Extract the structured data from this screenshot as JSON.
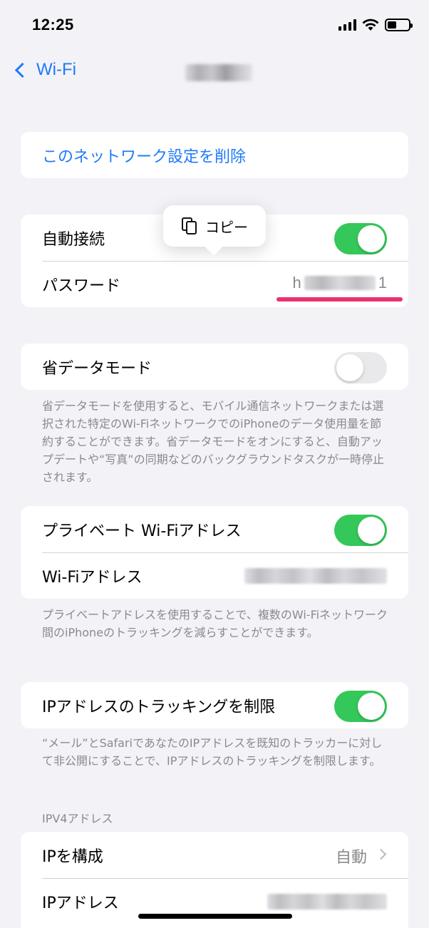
{
  "status_bar": {
    "time": "12:25"
  },
  "nav": {
    "back_label": "Wi-Fi"
  },
  "forget_network": {
    "label": "このネットワーク設定を削除"
  },
  "connection": {
    "auto_join": {
      "label": "自動接続",
      "on": true
    },
    "password": {
      "label": "パスワード",
      "first_char": "h",
      "last_char": "1"
    }
  },
  "copy_popup": {
    "label": "コピー"
  },
  "low_data": {
    "label": "省データモード",
    "on": false,
    "footnote": "省データモードを使用すると、モバイル通信ネットワークまたは選択された特定のWi-FiネットワークでのiPhoneのデータ使用量を節約することができます。省データモードをオンにすると、自動アップデートや“写真”の同期などのバックグラウンドタスクが一時停止されます。"
  },
  "private_address": {
    "label": "プライベート Wi-Fiアドレス",
    "on": true,
    "wifi_address_label": "Wi-Fiアドレス",
    "footnote": "プライベートアドレスを使用することで、複数のWi-Fiネットワーク間のiPhoneのトラッキングを減らすことができます。"
  },
  "limit_ip_tracking": {
    "label": "IPアドレスのトラッキングを制限",
    "on": true,
    "footnote": "“メール”とSafariであなたのIPアドレスを既知のトラッカーに対して非公開にすることで、IPアドレスのトラッキングを制限します。"
  },
  "ipv4": {
    "header": "IPV4アドレス",
    "configure_label": "IPを構成",
    "configure_value": "自動",
    "ip_address_label": "IPアドレス"
  },
  "colors": {
    "accent": "#1f7bf6",
    "toggle_on": "#34c759",
    "highlight": "#e8336d"
  }
}
